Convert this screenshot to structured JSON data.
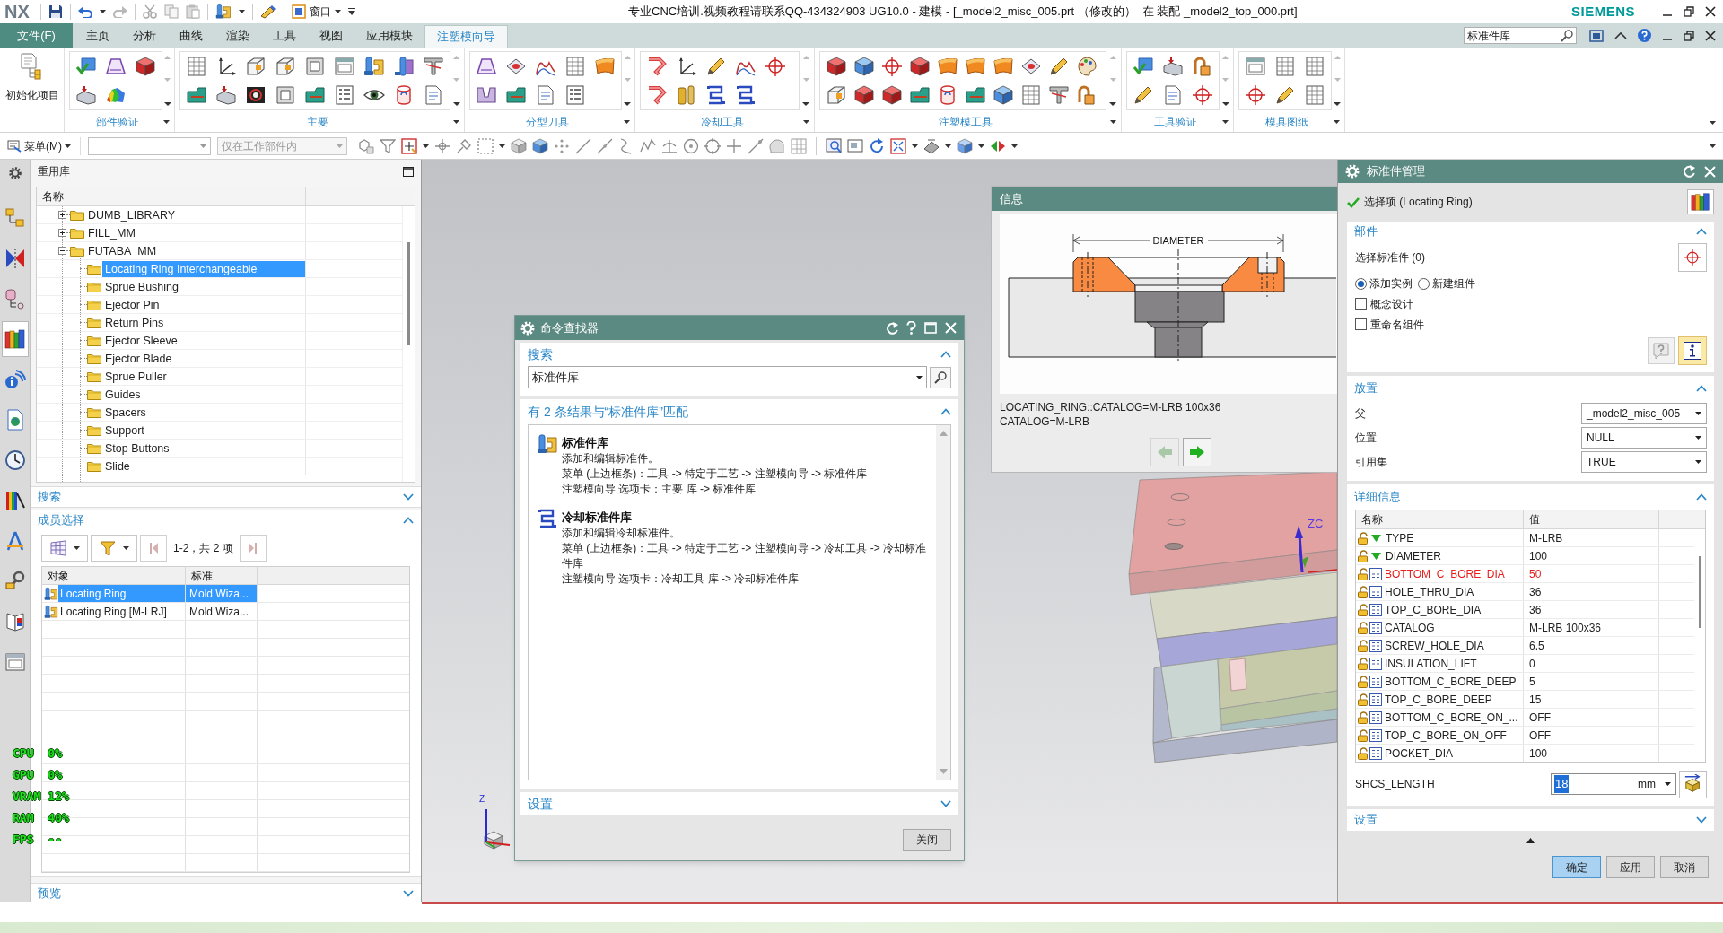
{
  "title_bar": {
    "logo": "NX",
    "window_menu": "窗口",
    "title": "专业CNC培训.视频教程请联系QQ-434324903 UG10.0 - 建模 - [_model2_misc_005.prt （修改的）  在 装配 _model2_top_000.prt]",
    "brand": "SIEMENS"
  },
  "ribbon": {
    "file_tab": "文件(F)",
    "tabs": [
      {
        "label": "主页",
        "selected": false
      },
      {
        "label": "分析",
        "selected": false
      },
      {
        "label": "曲线",
        "selected": false
      },
      {
        "label": "渲染",
        "selected": false
      },
      {
        "label": "工具",
        "selected": false
      },
      {
        "label": "视图",
        "selected": false
      },
      {
        "label": "应用模块",
        "selected": false
      },
      {
        "label": "注塑模向导",
        "selected": true
      }
    ],
    "search": {
      "value": "标准件库"
    },
    "init_button": "初始化项目",
    "groups": [
      {
        "label": "部件验证"
      },
      {
        "label": "主要"
      },
      {
        "label": "分型刀具"
      },
      {
        "label": "冷却工具"
      },
      {
        "label": "注塑模工具"
      },
      {
        "label": "工具验证"
      },
      {
        "label": "模具图纸"
      }
    ]
  },
  "command_bar": {
    "menu_button": "菜单(M)",
    "scope_dropdown": {
      "value": "仅在工作部件内",
      "disabled": true
    }
  },
  "resource_bar": {
    "tabs": [
      {
        "selected": false
      },
      {
        "selected": false
      },
      {
        "selected": false
      },
      {
        "selected": true
      },
      {
        "selected": false
      },
      {
        "selected": false
      },
      {
        "selected": false
      },
      {
        "selected": false
      },
      {
        "selected": false
      },
      {
        "selected": false
      },
      {
        "selected": false
      },
      {
        "selected": false
      }
    ]
  },
  "reuse_library": {
    "title": "重用库",
    "tree": {
      "column": "名称",
      "items": [
        {
          "label": "DUMB_LIBRARY",
          "expanded": false,
          "selected": false
        },
        {
          "label": "FILL_MM",
          "expanded": false,
          "selected": false
        },
        {
          "label": "FUTABA_MM",
          "expanded": true,
          "selected": false,
          "children": [
            {
              "label": "Locating Ring Interchangeable",
              "selected": true
            },
            {
              "label": "Sprue Bushing",
              "selected": false
            },
            {
              "label": "Ejector Pin",
              "selected": false
            },
            {
              "label": "Return Pins",
              "selected": false
            },
            {
              "label": "Ejector Sleeve",
              "selected": false
            },
            {
              "label": "Ejector Blade",
              "selected": false
            },
            {
              "label": "Sprue Puller",
              "selected": false
            },
            {
              "label": "Guides",
              "selected": false
            },
            {
              "label": "Spacers",
              "selected": false
            },
            {
              "label": "Support",
              "selected": false
            },
            {
              "label": "Stop Buttons",
              "selected": false
            },
            {
              "label": "Slide",
              "selected": false
            }
          ]
        }
      ]
    },
    "search_section": {
      "label": "搜索",
      "expanded": false
    },
    "member_section": {
      "label": "成员选择",
      "expanded": true,
      "pager": "1-2，共 2 项",
      "columns": [
        "对象",
        "标准"
      ],
      "rows": [
        {
          "cells": [
            "Locating Ring",
            "Mold Wiza..."
          ],
          "selected": true
        },
        {
          "cells": [
            "Locating Ring [M-LRJ]",
            "Mold Wiza..."
          ],
          "selected": false
        }
      ]
    },
    "preview_section": {
      "label": "预览",
      "expanded": false
    }
  },
  "perf_overlay": [
    {
      "label": "CPU",
      "value": "0%"
    },
    {
      "label": "GPU",
      "value": "0%"
    },
    {
      "label": "VRAM",
      "value": "12%"
    },
    {
      "label": "RAM",
      "value": "40%"
    },
    {
      "label": "FPS",
      "value": "--"
    }
  ],
  "graphics": {
    "axis_label": "ZC",
    "triad_label": "Z"
  },
  "info_window": {
    "title": "信息",
    "diagram_label": "DIAMETER",
    "lines": [
      "LOCATING_RING::CATALOG=M-LRB 100x36",
      "CATALOG=M-LRB"
    ],
    "previous_button": {
      "disabled": true
    },
    "next_button": {
      "disabled": false
    }
  },
  "command_finder": {
    "title": "命令查找器",
    "search_section": {
      "label": "搜索",
      "expanded": true
    },
    "query": "标准件库",
    "results_section": {
      "label": "有 2 条结果与“标准件库”匹配",
      "expanded": true
    },
    "results": [
      {
        "title": "标准件库",
        "lines": [
          "添加和编辑标准件。",
          "菜单 (上边框条)：工具 -> 特定于工艺 -> 注塑模向导 -> 标准件库",
          "注塑模向导 选项卡：主要 库 -> 标准件库"
        ]
      },
      {
        "title": "冷却标准件库",
        "lines": [
          "添加和编辑冷却标准件。",
          "菜单 (上边框条)：工具 -> 特定于工艺 -> 注塑模向导 -> 冷却工具 -> 冷却标准件库",
          "注塑模向导 选项卡：冷却工具 库 -> 冷却标准件库"
        ]
      }
    ],
    "settings_section": {
      "label": "设置",
      "expanded": false
    },
    "close_button": "关闭"
  },
  "standard_part_manager": {
    "title": "标准件管理",
    "selection": "选择项 (Locating Ring)",
    "parts_section": {
      "label": "部件",
      "expanded": true,
      "select_label": "选择标准件 (0)",
      "radios": [
        {
          "label": "添加实例",
          "selected": true
        },
        {
          "label": "新建组件",
          "selected": false
        }
      ],
      "checkboxes": [
        {
          "label": "概念设计",
          "checked": false
        },
        {
          "label": "重命名组件",
          "checked": false
        }
      ]
    },
    "placement_section": {
      "label": "放置",
      "expanded": true,
      "fields": [
        {
          "label": "父",
          "value": "_model2_misc_005"
        },
        {
          "label": "位置",
          "value": "NULL"
        },
        {
          "label": "引用集",
          "value": "TRUE"
        }
      ]
    },
    "details_section": {
      "label": "详细信息",
      "expanded": true,
      "columns": [
        "名称",
        "值"
      ],
      "rows": [
        {
          "kind": "option",
          "name": "TYPE",
          "value": "M-LRB",
          "modified": false
        },
        {
          "kind": "option",
          "name": "DIAMETER",
          "value": "100",
          "modified": false
        },
        {
          "kind": "parameter",
          "name": "BOTTOM_C_BORE_DIA",
          "value": "50",
          "modified": true
        },
        {
          "kind": "parameter",
          "name": "HOLE_THRU_DIA",
          "value": "36",
          "modified": false
        },
        {
          "kind": "parameter",
          "name": "TOP_C_BORE_DIA",
          "value": "36",
          "modified": false
        },
        {
          "kind": "parameter",
          "name": "CATALOG",
          "value": "M-LRB 100x36",
          "modified": false
        },
        {
          "kind": "parameter",
          "name": "SCREW_HOLE_DIA",
          "value": "6.5",
          "modified": false
        },
        {
          "kind": "parameter",
          "name": "INSULATION_LIFT",
          "value": "0",
          "modified": false
        },
        {
          "kind": "parameter",
          "name": "BOTTOM_C_BORE_DEEP",
          "value": "5",
          "modified": false
        },
        {
          "kind": "parameter",
          "name": "TOP_C_BORE_DEEP",
          "value": "15",
          "modified": false
        },
        {
          "kind": "parameter",
          "name": "BOTTOM_C_BORE_ON_...",
          "value": "OFF",
          "modified": false
        },
        {
          "kind": "parameter",
          "name": "TOP_C_BORE_ON_OFF",
          "value": "OFF",
          "modified": false
        },
        {
          "kind": "parameter",
          "name": "POCKET_DIA",
          "value": "100",
          "modified": false
        }
      ],
      "length_field": {
        "label": "SHCS_LENGTH",
        "value": "18",
        "text_selected": true,
        "unit": "mm"
      }
    },
    "settings_section": {
      "label": "设置",
      "expanded": false
    },
    "buttons": [
      {
        "label": "确定",
        "default": true
      },
      {
        "label": "应用",
        "default": false
      },
      {
        "label": "取消",
        "default": false
      }
    ]
  }
}
